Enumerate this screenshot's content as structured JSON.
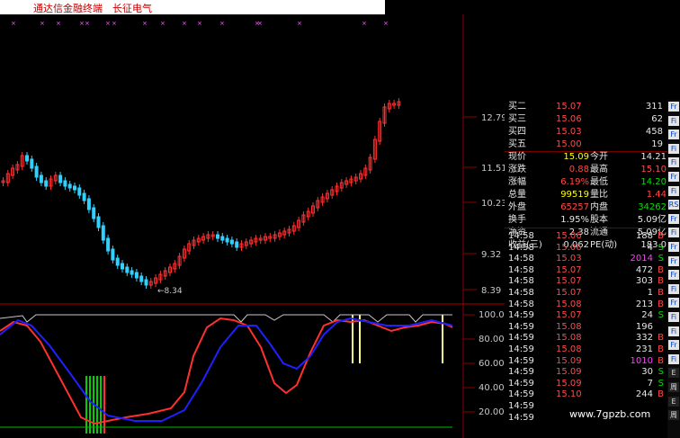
{
  "window": {
    "app_title": "通达信金融终端",
    "stock_title": "长征电气"
  },
  "price_axis": {
    "labels": [
      "12.79",
      "11.51",
      "10.23",
      "9.32",
      "8.39"
    ],
    "low_marker": "←8.34"
  },
  "indicator_axis": {
    "labels": [
      "100.0",
      "80.00",
      "60.00",
      "40.00",
      "20.00"
    ]
  },
  "order_book": [
    {
      "label": "买二",
      "price": "15.07",
      "volume": "311"
    },
    {
      "label": "买三",
      "price": "15.06",
      "volume": "62"
    },
    {
      "label": "买四",
      "price": "15.03",
      "volume": "458"
    },
    {
      "label": "买五",
      "price": "15.00",
      "volume": "19"
    }
  ],
  "quote": {
    "r1": {
      "l1": "现价",
      "v1": "15.09",
      "l2": "今开",
      "v2": "14.21"
    },
    "r2": {
      "l1": "涨跌",
      "v1": "0.88",
      "l2": "最高",
      "v2": "15.10"
    },
    "r3": {
      "l1": "涨幅",
      "v1": "6.19%",
      "l2": "最低",
      "v2": "14.20"
    },
    "r4": {
      "l1": "总量",
      "v1": "99519",
      "l2": "量比",
      "v2": "1.44"
    },
    "r5": {
      "l1": "外盘",
      "v1": "65257",
      "l2": "内盘",
      "v2": "34262"
    },
    "r6": {
      "l1": "换手",
      "v1": "1.95%",
      "l2": "股本",
      "v2": "5.09亿"
    },
    "r7": {
      "l1": "净资",
      "v1": "2.38",
      "l2": "流通",
      "v2": "5.09亿"
    },
    "r8": {
      "l1": "收益(三)",
      "v1": "0.062",
      "l2": "PE(动)",
      "v2": "183.0"
    }
  },
  "ticks": [
    {
      "time": "14:58",
      "price": "15.06",
      "vol": "188",
      "side": "B"
    },
    {
      "time": "14:58",
      "price": "15.06",
      "vol": "4",
      "side": "S"
    },
    {
      "time": "14:58",
      "price": "15.03",
      "vol": "2014",
      "side": "S"
    },
    {
      "time": "14:58",
      "price": "15.07",
      "vol": "472",
      "side": "B"
    },
    {
      "time": "14:58",
      "price": "15.07",
      "vol": "303",
      "side": "B"
    },
    {
      "time": "14:58",
      "price": "15.07",
      "vol": "1",
      "side": "B"
    },
    {
      "time": "14:58",
      "price": "15.08",
      "vol": "213",
      "side": "B"
    },
    {
      "time": "14:59",
      "price": "15.07",
      "vol": "24",
      "side": "S"
    },
    {
      "time": "14:59",
      "price": "15.08",
      "vol": "196",
      "side": ""
    },
    {
      "time": "14:59",
      "price": "15.08",
      "vol": "332",
      "side": "B"
    },
    {
      "time": "14:59",
      "price": "15.08",
      "vol": "231",
      "side": "B"
    },
    {
      "time": "14:59",
      "price": "15.09",
      "vol": "1010",
      "side": "B"
    },
    {
      "time": "14:59",
      "price": "15.09",
      "vol": "30",
      "side": "S"
    },
    {
      "time": "14:59",
      "price": "15.09",
      "vol": "7",
      "side": "S"
    },
    {
      "time": "14:59",
      "price": "15.10",
      "vol": "244",
      "side": "B"
    },
    {
      "time": "14:59",
      "price": "",
      "vol": "",
      "side": ""
    },
    {
      "time": "14:59",
      "price": "",
      "vol": "",
      "side": ""
    }
  ],
  "toolstrip": [
    "Fr",
    "Fi",
    "Fr",
    "Fi",
    "Fi",
    "Fr",
    "Fi",
    "RS",
    "Fr",
    "Fi",
    "Fr",
    "Fr",
    "Fr",
    "Fi",
    "Fr",
    "Fi",
    "Fi",
    "Fr",
    "Fi",
    "E",
    "周",
    "E",
    "周"
  ],
  "watermark": "www.7gpzb.com",
  "colors": {
    "up": "#ff3030",
    "down": "#30d0ff",
    "k": "#ff3030",
    "d": "#2020ff",
    "signal": "#ffff80"
  }
}
